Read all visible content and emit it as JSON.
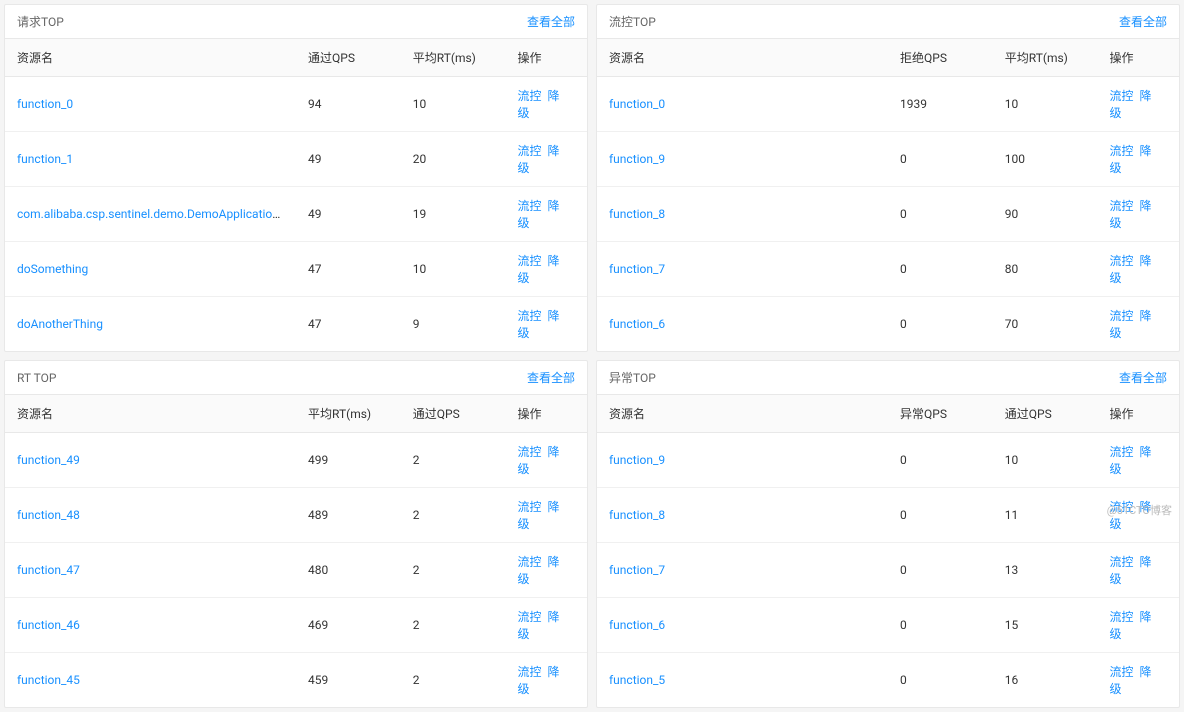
{
  "labels": {
    "view_all": "查看全部",
    "action_flow": "流控",
    "action_degrade": "降级"
  },
  "panels": [
    {
      "title": "请求TOP",
      "columns": [
        "资源名",
        "通过QPS",
        "平均RT(ms)",
        "操作"
      ],
      "rows": [
        {
          "name": "function_0",
          "c1": "94",
          "c2": "10"
        },
        {
          "name": "function_1",
          "c1": "49",
          "c2": "20"
        },
        {
          "name": "com.alibaba.csp.sentinel.demo.DemoApplication:getUserById(java.l...",
          "c1": "49",
          "c2": "19"
        },
        {
          "name": "doSomething",
          "c1": "47",
          "c2": "10"
        },
        {
          "name": "doAnotherThing",
          "c1": "47",
          "c2": "9"
        }
      ]
    },
    {
      "title": "流控TOP",
      "columns": [
        "资源名",
        "拒绝QPS",
        "平均RT(ms)",
        "操作"
      ],
      "rows": [
        {
          "name": "function_0",
          "c1": "1939",
          "c2": "10"
        },
        {
          "name": "function_9",
          "c1": "0",
          "c2": "100"
        },
        {
          "name": "function_8",
          "c1": "0",
          "c2": "90"
        },
        {
          "name": "function_7",
          "c1": "0",
          "c2": "80"
        },
        {
          "name": "function_6",
          "c1": "0",
          "c2": "70"
        }
      ]
    },
    {
      "title": "RT TOP",
      "columns": [
        "资源名",
        "平均RT(ms)",
        "通过QPS",
        "操作"
      ],
      "rows": [
        {
          "name": "function_49",
          "c1": "499",
          "c2": "2"
        },
        {
          "name": "function_48",
          "c1": "489",
          "c2": "2"
        },
        {
          "name": "function_47",
          "c1": "480",
          "c2": "2"
        },
        {
          "name": "function_46",
          "c1": "469",
          "c2": "2"
        },
        {
          "name": "function_45",
          "c1": "459",
          "c2": "2"
        }
      ]
    },
    {
      "title": "异常TOP",
      "columns": [
        "资源名",
        "异常QPS",
        "通过QPS",
        "操作"
      ],
      "rows": [
        {
          "name": "function_9",
          "c1": "0",
          "c2": "10"
        },
        {
          "name": "function_8",
          "c1": "0",
          "c2": "11"
        },
        {
          "name": "function_7",
          "c1": "0",
          "c2": "13"
        },
        {
          "name": "function_6",
          "c1": "0",
          "c2": "15"
        },
        {
          "name": "function_5",
          "c1": "0",
          "c2": "16"
        }
      ]
    }
  ],
  "watermark": "@51CTO博客"
}
